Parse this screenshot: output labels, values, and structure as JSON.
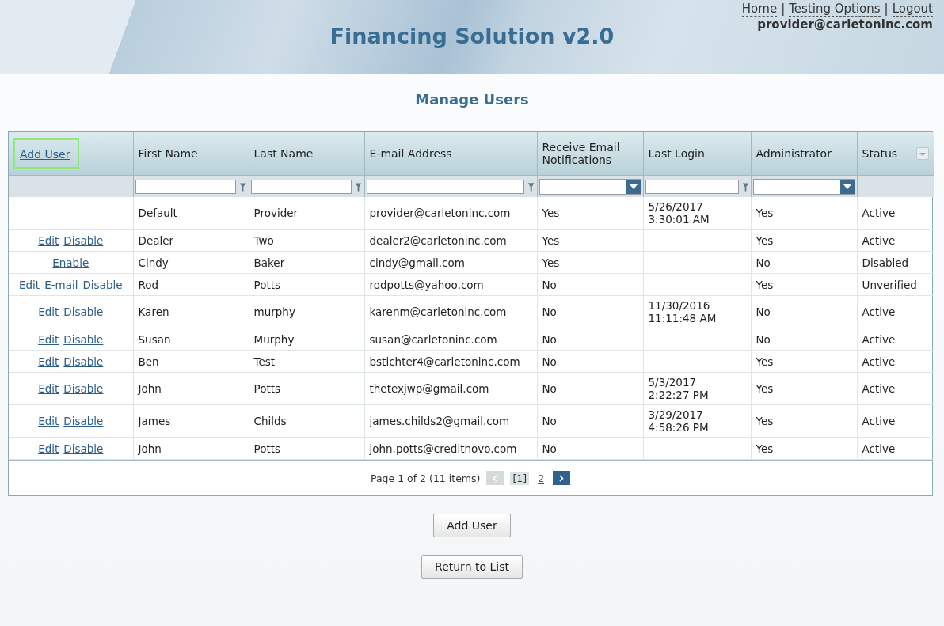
{
  "header": {
    "title": "Financing Solution v2.0",
    "links": [
      {
        "kind": "link",
        "text": "Home"
      },
      {
        "kind": "separator",
        "text": "|"
      },
      {
        "kind": "link",
        "text": "Testing Options"
      },
      {
        "kind": "separator",
        "text": "|"
      },
      {
        "kind": "link",
        "text": "Logout"
      }
    ],
    "user": "provider@carletoninc.com"
  },
  "page_title": "Manage Users",
  "table": {
    "add_link": {
      "label": "Add User",
      "focused": true
    },
    "columns": [
      {
        "label": "First Name",
        "kind": "text"
      },
      {
        "label": "Last Name",
        "kind": "text"
      },
      {
        "label": "E-mail Address",
        "kind": "text"
      },
      {
        "label": "Receive Email Notifications",
        "kind": "dropdown"
      },
      {
        "label": "Last Login",
        "kind": "text"
      },
      {
        "label": "Administrator",
        "kind": "dropdown"
      },
      {
        "label": "Status",
        "kind": "plain"
      }
    ],
    "rows": [
      {
        "actions": [],
        "cells": [
          "Default",
          "Provider",
          "provider@carletoninc.com",
          "Yes",
          "5/26/2017 3:30:01 AM",
          "Yes",
          "Active"
        ]
      },
      {
        "actions": [
          "Edit",
          "Disable"
        ],
        "cells": [
          "Dealer",
          "Two",
          "dealer2@carletoninc.com",
          "Yes",
          "",
          "Yes",
          "Active"
        ]
      },
      {
        "actions": [
          "Enable"
        ],
        "cells": [
          "Cindy",
          "Baker",
          "cindy@gmail.com",
          "Yes",
          "",
          "No",
          "Disabled"
        ]
      },
      {
        "actions": [
          "Edit",
          "E-mail",
          "Disable"
        ],
        "cells": [
          "Rod",
          "Potts",
          "rodpotts@yahoo.com",
          "No",
          "",
          "Yes",
          "Unverified"
        ]
      },
      {
        "actions": [
          "Edit",
          "Disable"
        ],
        "cells": [
          "Karen",
          "murphy",
          "karenm@carletoninc.com",
          "No",
          "11/30/2016 11:11:48 AM",
          "No",
          "Active"
        ]
      },
      {
        "actions": [
          "Edit",
          "Disable"
        ],
        "cells": [
          "Susan",
          "Murphy",
          "susan@carletoninc.com",
          "No",
          "",
          "No",
          "Active"
        ]
      },
      {
        "actions": [
          "Edit",
          "Disable"
        ],
        "cells": [
          "Ben",
          "Test",
          "bstichter4@carletoninc.com",
          "No",
          "",
          "Yes",
          "Active"
        ]
      },
      {
        "actions": [
          "Edit",
          "Disable"
        ],
        "cells": [
          "John",
          "Potts",
          "thetexjwp@gmail.com",
          "No",
          "5/3/2017 2:22:27 PM",
          "Yes",
          "Active"
        ]
      },
      {
        "actions": [
          "Edit",
          "Disable"
        ],
        "cells": [
          "James",
          "Childs",
          "james.childs2@gmail.com",
          "No",
          "3/29/2017 4:58:26 PM",
          "Yes",
          "Active"
        ]
      },
      {
        "actions": [
          "Edit",
          "Disable"
        ],
        "cells": [
          "John",
          "Potts",
          "john.potts@creditnovo.com",
          "No",
          "",
          "Yes",
          "Active"
        ]
      }
    ],
    "pager": {
      "summary": "Page 1 of 2 (11 items)",
      "prev_disabled": true,
      "next_disabled": false,
      "pages": [
        {
          "label": "[1]",
          "selected": true
        },
        {
          "label": "2",
          "selected": false
        }
      ]
    }
  },
  "buttons": [
    "Add User",
    "Return to List"
  ]
}
